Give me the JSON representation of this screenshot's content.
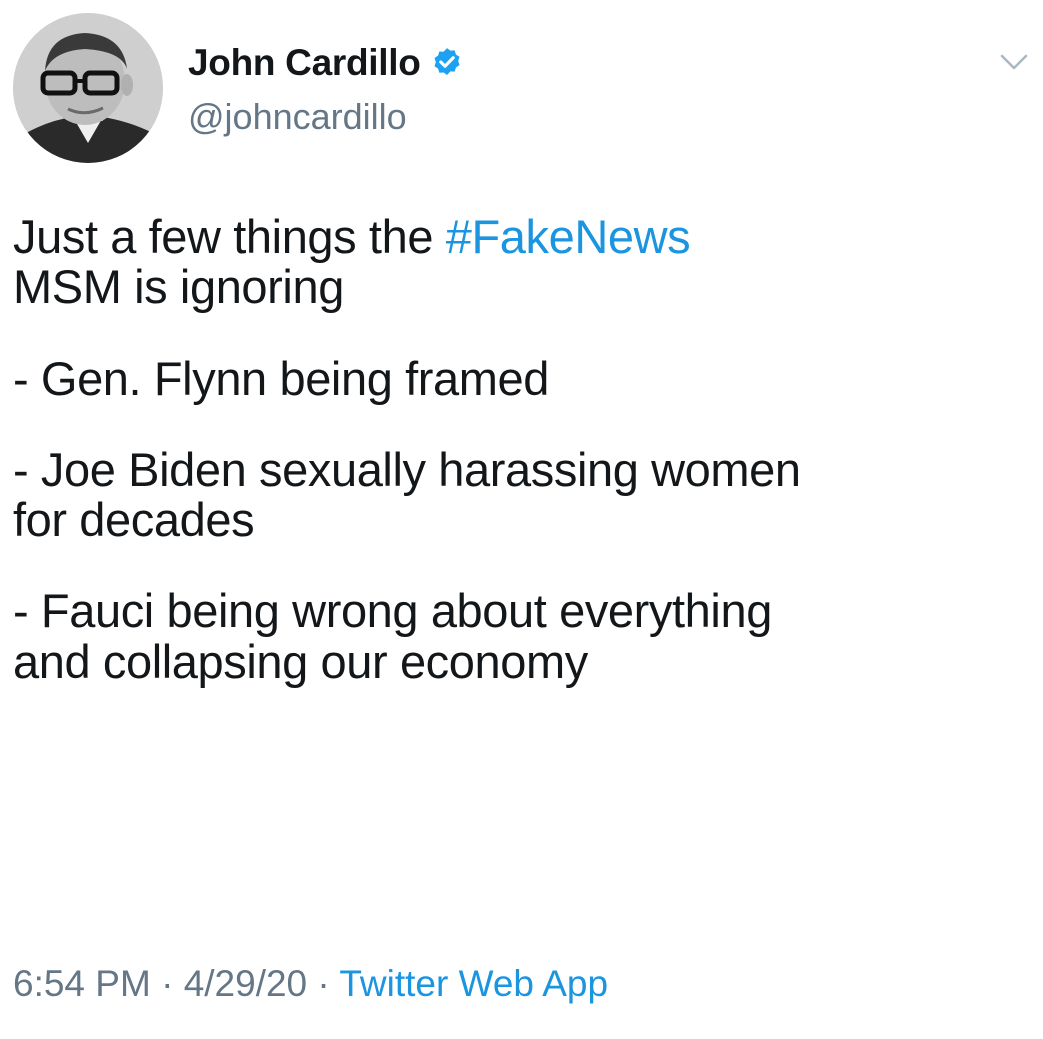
{
  "author": {
    "display_name": "John Cardillo",
    "handle": "@johncardillo",
    "verified_icon": "verified-badge-icon",
    "avatar_icon": "profile-photo"
  },
  "menu": {
    "icon": "chevron-down-icon"
  },
  "tweet": {
    "intro_before": "Just a few things the ",
    "hashtag": "#FakeNews",
    "intro_line2": "MSM is ignoring",
    "item1": "- Gen. Flynn being framed",
    "item2_line1": "- Joe Biden sexually harassing women",
    "item2_line2": "for decades",
    "item3_line1": "- Fauci being wrong about everything",
    "item3_line2": "and collapsing our economy"
  },
  "meta": {
    "time": "6:54 PM",
    "sep1": " · ",
    "date": "4/29/20",
    "sep2": " · ",
    "source": "Twitter Web App"
  },
  "colors": {
    "link": "#1b95e0",
    "secondary_text": "#657786",
    "primary_text": "#14171a",
    "verified": "#1da1f2"
  }
}
